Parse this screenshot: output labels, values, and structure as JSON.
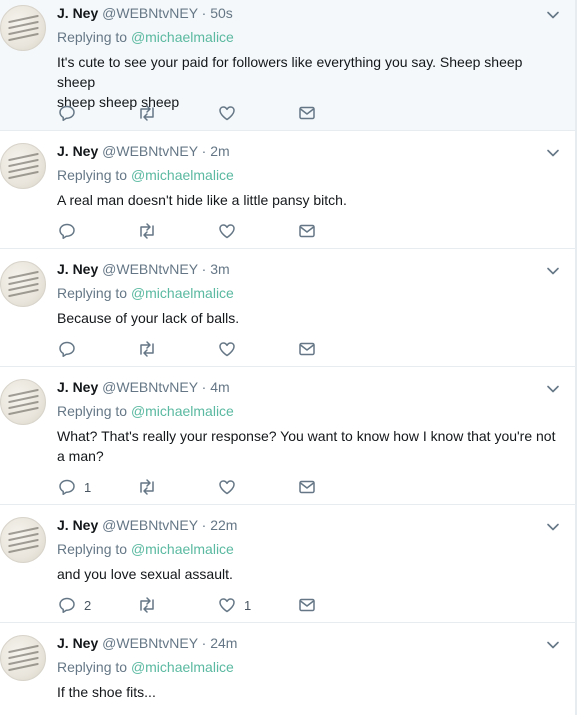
{
  "tweets": [
    {
      "name": "J. Ney",
      "handle": "@WEBNtvNEY",
      "time": "50s",
      "replying_prefix": "Replying to",
      "replying_to": "@michaelmalice",
      "text_lines": [
        "It's cute to see your paid for followers like everything you say. Sheep sheep sheep",
        "sheep sheep sheep"
      ],
      "reply_count": "",
      "retweet_count": "",
      "like_count": ""
    },
    {
      "name": "J. Ney",
      "handle": "@WEBNtvNEY",
      "time": "2m",
      "replying_prefix": "Replying to",
      "replying_to": "@michaelmalice",
      "text_lines": [
        "A real man doesn't hide like a little pansy bitch."
      ],
      "reply_count": "",
      "retweet_count": "",
      "like_count": ""
    },
    {
      "name": "J. Ney",
      "handle": "@WEBNtvNEY",
      "time": "3m",
      "replying_prefix": "Replying to",
      "replying_to": "@michaelmalice",
      "text_lines": [
        "Because of your lack of balls."
      ],
      "reply_count": "",
      "retweet_count": "",
      "like_count": ""
    },
    {
      "name": "J. Ney",
      "handle": "@WEBNtvNEY",
      "time": "4m",
      "replying_prefix": "Replying to",
      "replying_to": "@michaelmalice",
      "text_lines": [
        "What? That's really your response? You want to know how I know that you're not",
        "a man?"
      ],
      "reply_count": "1",
      "retweet_count": "",
      "like_count": ""
    },
    {
      "name": "J. Ney",
      "handle": "@WEBNtvNEY",
      "time": "22m",
      "replying_prefix": "Replying to",
      "replying_to": "@michaelmalice",
      "text_lines": [
        "and you love sexual assault."
      ],
      "reply_count": "2",
      "retweet_count": "",
      "like_count": "1"
    },
    {
      "name": "J. Ney",
      "handle": "@WEBNtvNEY",
      "time": "24m",
      "replying_prefix": "Replying to",
      "replying_to": "@michaelmalice",
      "text_lines": [
        "If the shoe fits..."
      ],
      "reply_count": "",
      "retweet_count": "",
      "like_count": ""
    }
  ],
  "separator": "·",
  "colors": {
    "mention": "#5ab9a0",
    "meta": "#657786",
    "highlight_bg": "#f5f8fa",
    "border": "#e6ecf0"
  },
  "icons": [
    "chevron-down-icon",
    "reply-icon",
    "retweet-icon",
    "like-icon",
    "message-icon"
  ]
}
